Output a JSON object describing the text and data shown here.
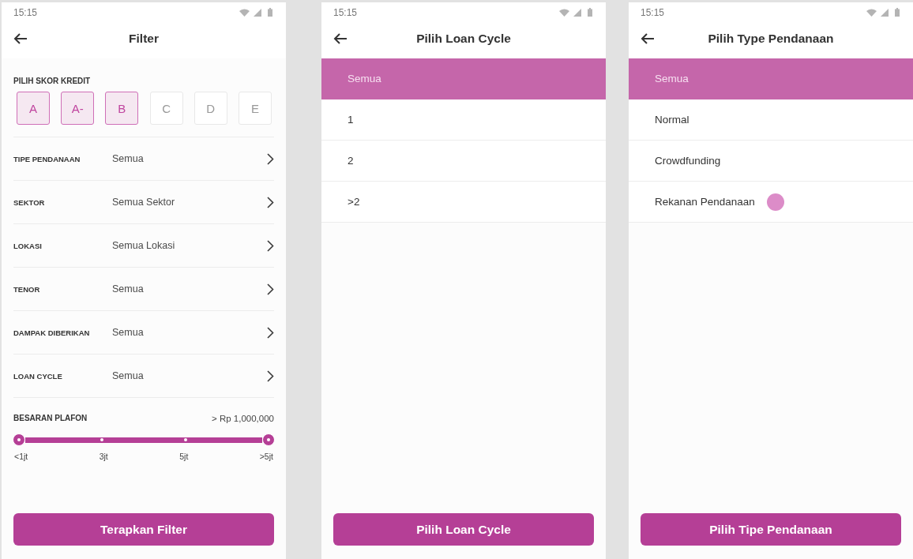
{
  "screens": [
    {
      "kind": "filter",
      "status_bar": {
        "time": "15:15"
      },
      "header": {
        "title": "Filter"
      },
      "credit_score": {
        "label": "PILIH SKOR KREDIT",
        "options": [
          {
            "label": "A",
            "selected": true
          },
          {
            "label": "A-",
            "selected": true
          },
          {
            "label": "B",
            "selected": true
          },
          {
            "label": "C",
            "selected": false
          },
          {
            "label": "D",
            "selected": false
          },
          {
            "label": "E",
            "selected": false
          }
        ]
      },
      "filters": [
        {
          "label": "TIPE PENDANAAN",
          "value": "Semua"
        },
        {
          "label": "SEKTOR",
          "value": "Semua Sektor"
        },
        {
          "label": "LOKASI",
          "value": "Semua Lokasi"
        },
        {
          "label": "TENOR",
          "value": "Semua"
        },
        {
          "label": "DAMPAK DIBERIKAN",
          "value": "Semua"
        },
        {
          "label": "LOAN CYCLE",
          "value": "Semua"
        }
      ],
      "plafon": {
        "label": "BESARAN PLAFON",
        "reading": "> Rp 1,000,000",
        "level": 1,
        "ticks": [
          "<1jt",
          "3jt",
          "5jt",
          ">5jt"
        ]
      },
      "button": "Terapkan Filter"
    },
    {
      "kind": "list",
      "status_bar": {
        "time": "15:15"
      },
      "header": {
        "title": "Pilih Loan Cycle"
      },
      "options": [
        {
          "label": "Semua",
          "selected": true,
          "touched": false
        },
        {
          "label": "1",
          "selected": false,
          "touched": false
        },
        {
          "label": "2",
          "selected": false,
          "touched": false
        },
        {
          "label": ">2",
          "selected": false,
          "touched": false
        }
      ],
      "button": "Pilih Loan Cycle"
    },
    {
      "kind": "list",
      "status_bar": {
        "time": "15:15"
      },
      "header": {
        "title": "Pilih Type Pendanaan"
      },
      "options": [
        {
          "label": "Semua",
          "selected": true,
          "touched": false
        },
        {
          "label": "Normal",
          "selected": false,
          "touched": false
        },
        {
          "label": "Crowdfunding",
          "selected": false,
          "touched": false
        },
        {
          "label": "Rekanan Pendanaan",
          "selected": false,
          "touched": true
        }
      ],
      "button": "Pilih Tipe Pendanaan"
    }
  ]
}
